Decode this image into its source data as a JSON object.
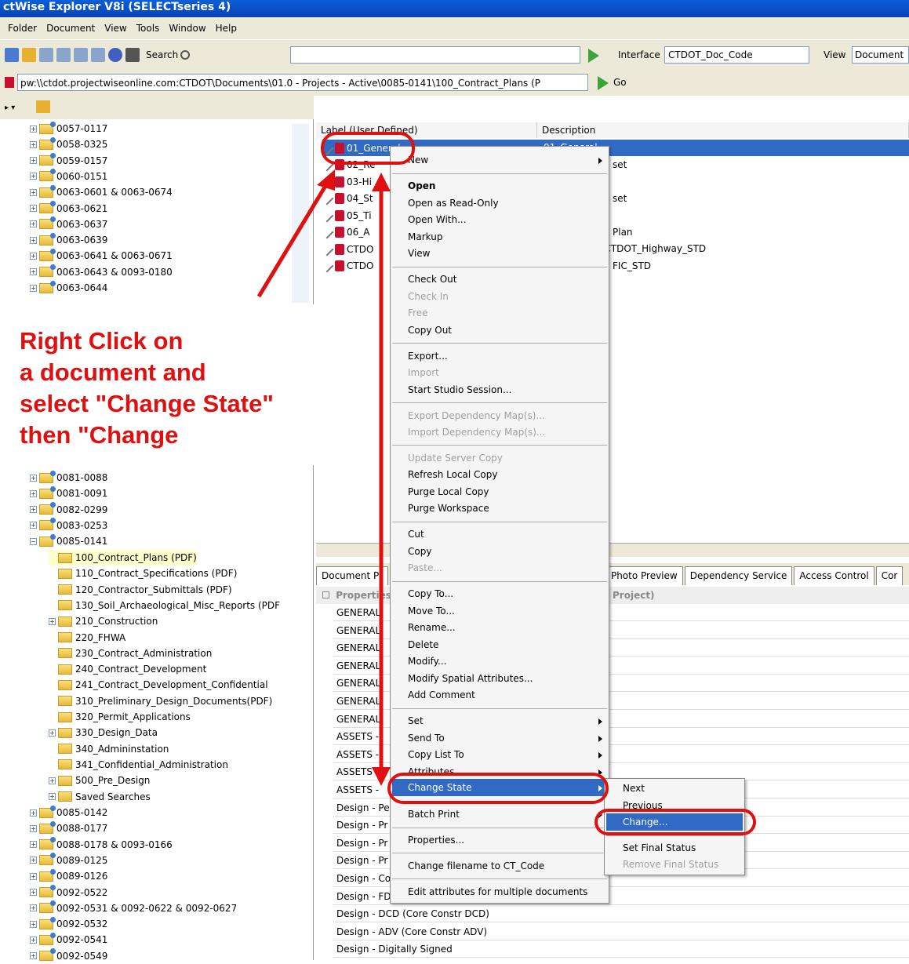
{
  "window": {
    "title": "ctWise Explorer V8i (SELECTseries 4)"
  },
  "menubar": [
    "Folder",
    "Document",
    "View",
    "Tools",
    "Window",
    "Help"
  ],
  "toolbar": {
    "search_label": "Search",
    "interface_label": "Interface",
    "interface_value": "CTDOT_Doc_Code",
    "view_label": "View",
    "view_value": "Document"
  },
  "address": {
    "path": "pw:\\\\ctdot.projectwiseonline.com:CTDOT\\Documents\\01.0 - Projects - Active\\0085-0141\\100_Contract_Plans (P",
    "go_label": "Go"
  },
  "tree": {
    "top_items": [
      "0057-0117",
      "0058-0325",
      "0059-0157",
      "0060-0151",
      "0063-0601 & 0063-0674",
      "0063-0621",
      "0063-0637",
      "0063-0639",
      "0063-0641 & 0063-0671",
      "0063-0643 & 0093-0180",
      "0063-0644"
    ],
    "bottom_items": [
      "0081-0088",
      "0081-0091",
      "0082-0299",
      "0083-0253",
      "0085-0141"
    ],
    "subfolders": [
      "100_Contract_Plans (PDF)",
      "110_Contract_Specifications (PDF)",
      "120_Contractor_Submittals (PDF)",
      "130_Soil_Archaeological_Misc_Reports (PDF",
      "210_Construction",
      "220_FHWA",
      "230_Contract_Administration",
      "240_Contract_Development",
      "241_Contract_Development_Confidential",
      "310_Preliminary_Design_Documents(PDF)",
      "320_Permit_Applications",
      "330_Design_Data",
      "340_Admininstation",
      "341_Confidential_Administration",
      "500_Pre_Design",
      "Saved Searches"
    ],
    "after_items": [
      "0085-0142",
      "0088-0177",
      "0088-0178 & 0093-0166",
      "0089-0125",
      "0089-0126",
      "0092-0522",
      "0092-0531 & 0092-0622 & 0092-0627",
      "0092-0532",
      "0092-0541",
      "0092-0549"
    ]
  },
  "filelist": {
    "col_label": "Label (User Defined)",
    "col_desc": "Description",
    "rows": [
      {
        "label": "01_General",
        "desc": "01_General"
      },
      {
        "label": "02_Re",
        "desc": "set"
      },
      {
        "label": "03-Hi",
        "desc": ""
      },
      {
        "label": "04_St",
        "desc": "set"
      },
      {
        "label": "05_Ti",
        "desc": ""
      },
      {
        "label": "06_A",
        "desc": "Plan"
      },
      {
        "label": "CTDO",
        "desc": "_0085-0141_CTDOT_Highway_STD"
      },
      {
        "label": "CTDO",
        "desc": "FIC_STD"
      }
    ]
  },
  "tabs": [
    "Document Pr",
    "Photo Preview",
    "Dependency Service",
    "Access Control",
    "Cor"
  ],
  "props": {
    "header": "Properties",
    "header_right": "Project)",
    "rows": [
      "GENERAL",
      "GENERAL",
      "GENERAL",
      "GENERAL",
      "GENERAL",
      "GENERAL",
      "GENERAL",
      "ASSETS -",
      "ASSETS -",
      "ASSETS -",
      "ASSETS -",
      "Design - Pe",
      "Design - Pr",
      "Design - Pr",
      "Design - Pr",
      "Design - Co",
      "Design - FD",
      "Design - DCD (Core Constr DCD)",
      "Design - ADV (Core Constr ADV)",
      "Design - Digitally Signed"
    ]
  },
  "context_menu": {
    "new": "New",
    "open": "Open",
    "open_ro": "Open as Read-Only",
    "open_with": "Open With...",
    "markup": "Markup",
    "view": "View",
    "check_out": "Check Out",
    "check_in": "Check In",
    "free": "Free",
    "copy_out": "Copy Out",
    "export": "Export...",
    "import": "Import",
    "studio": "Start Studio Session...",
    "export_dep": "Export Dependency Map(s)...",
    "import_dep": "Import Dependency Map(s)...",
    "update_server": "Update Server Copy",
    "refresh_local": "Refresh Local Copy",
    "purge_local": "Purge Local Copy",
    "purge_ws": "Purge Workspace",
    "cut": "Cut",
    "copy": "Copy",
    "paste": "Paste...",
    "copy_to": "Copy To...",
    "move_to": "Move To...",
    "rename": "Rename...",
    "delete": "Delete",
    "modify": "Modify...",
    "modify_spatial": "Modify Spatial Attributes...",
    "add_comment": "Add Comment",
    "set": "Set",
    "send_to": "Send To",
    "copy_list": "Copy List To",
    "attributes": "Attributes",
    "change_state": "Change State",
    "batch_print": "Batch Print",
    "properties": "Properties...",
    "change_filename": "Change filename to CT_Code",
    "edit_attrs": "Edit attributes for multiple documents"
  },
  "submenu": {
    "next": "Next",
    "previous": "Previous",
    "change": "Change...",
    "set_final": "Set Final Status",
    "remove_final": "Remove Final Status"
  },
  "annotation": {
    "line1": "Right Click on",
    "line2": "a document and",
    "line3": "select \"Change State\"",
    "line4": "then \"Change"
  },
  "colors": {
    "accent": "#e01010",
    "highlight": "#316ac5"
  }
}
